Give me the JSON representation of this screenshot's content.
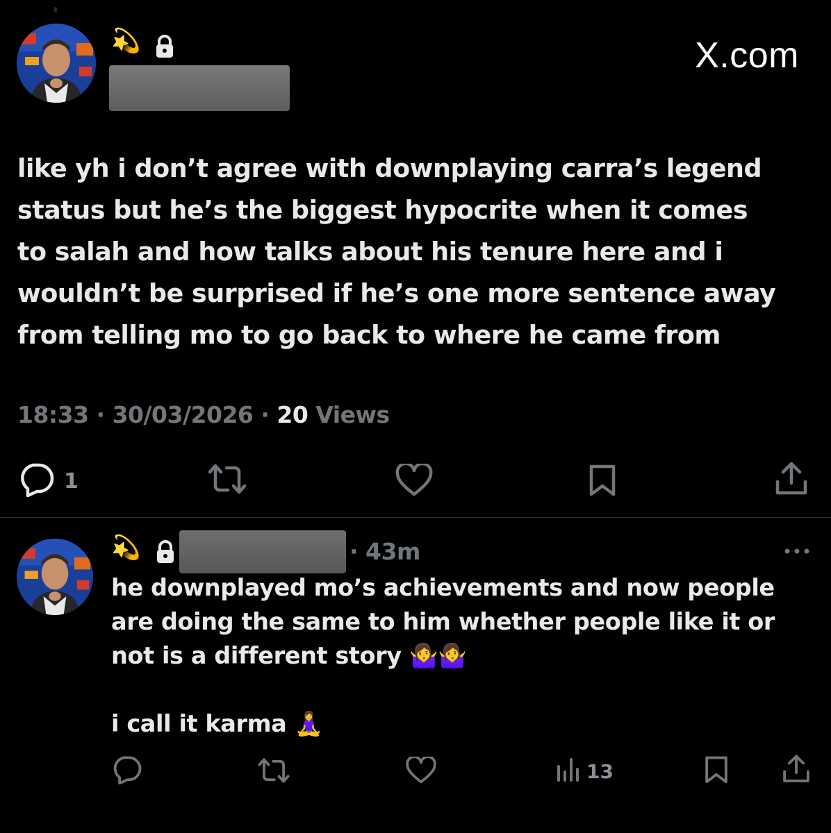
{
  "main_tweet": {
    "badge_emoji": "💫",
    "lock_icon": "lock-icon",
    "watermark": "X.com",
    "text_lines": [
      "like yh i don’t agree with downplaying carra’s legend",
      "status but he’s the biggest hypocrite when it comes",
      "to salah and how talks about his tenure here and i",
      "wouldn’t be surprised if he’s one more sentence away",
      "from telling mo to go back to where he came from"
    ],
    "time": "18:33",
    "date": "30/03/2026",
    "separator": "·",
    "views_count": "20",
    "views_label": "Views",
    "actions": {
      "reply_count": "1"
    }
  },
  "reply_tweet": {
    "badge_emoji": "💫",
    "time_ago": "· 43m",
    "text_lines": [
      "he downplayed mo’s achievements and now people",
      "are doing the same to him whether people like it or",
      "not is a different story 🤷‍♀️🤷‍♀️"
    ],
    "text_after_gap": "i call it karma 🧘‍♀️",
    "views_count": "13"
  },
  "colors": {
    "background": "#000000",
    "text_primary": "#e7e9ea",
    "text_secondary": "#71767b",
    "divider": "#2f3336"
  }
}
